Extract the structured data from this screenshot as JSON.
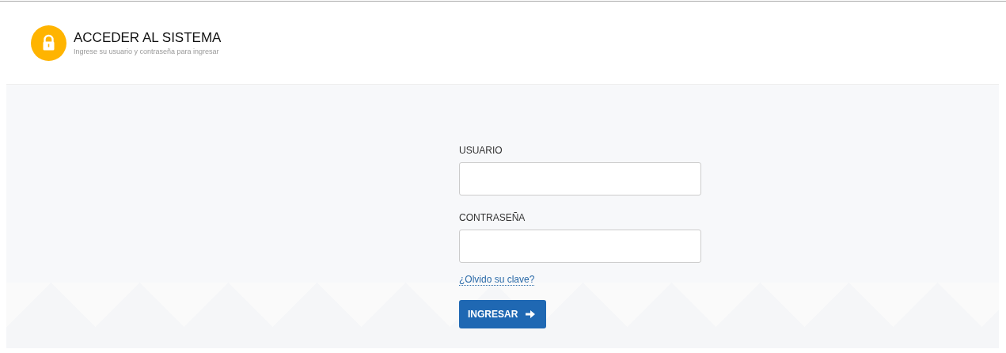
{
  "header": {
    "title": "ACCEDER AL SISTEMA",
    "subtitle": "Ingrese su usuario y contraseña para ingresar"
  },
  "form": {
    "fields": [
      {
        "label": "USUARIO"
      },
      {
        "label": "CONTRASEÑA"
      }
    ],
    "forgot_link": "¿Olvido su clave?",
    "submit_button": "INGRESAR"
  }
}
